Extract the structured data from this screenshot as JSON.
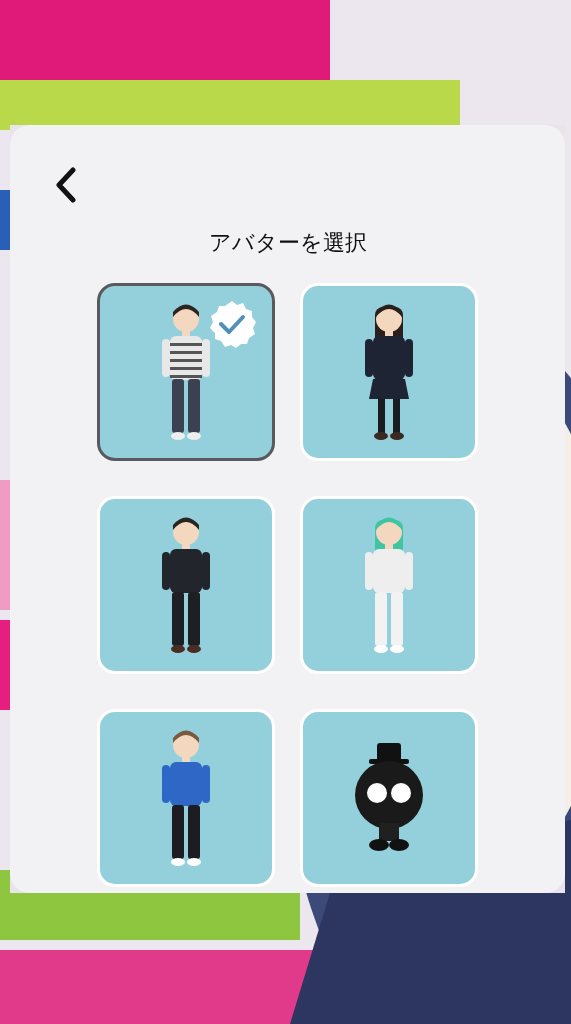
{
  "title": "アバターを選択",
  "avatars": [
    {
      "kind": "tee",
      "selected": true
    },
    {
      "kind": "uniform",
      "selected": false
    },
    {
      "kind": "suit",
      "selected": false
    },
    {
      "kind": "tracksuit",
      "selected": false
    },
    {
      "kind": "hoodie",
      "selected": false
    },
    {
      "kind": "mascot",
      "selected": false
    }
  ]
}
